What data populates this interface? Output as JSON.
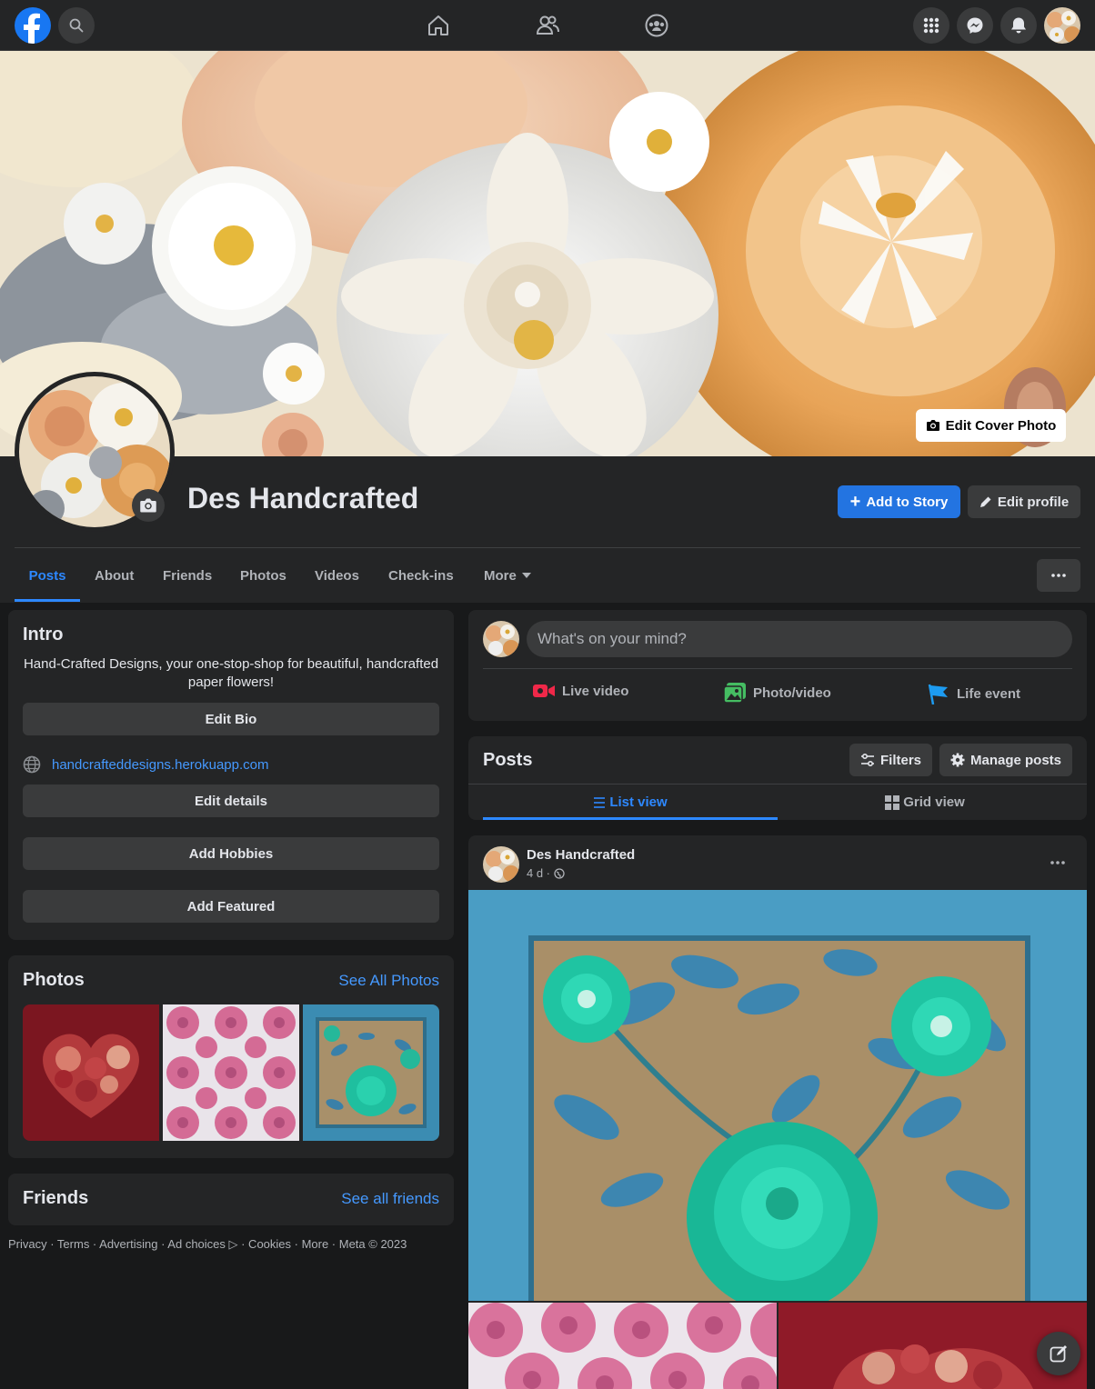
{
  "nav": {
    "icons": [
      "facebook-logo-icon",
      "search-icon",
      "home-icon",
      "friends-icon",
      "groups-icon",
      "menu-grid-icon",
      "messenger-icon",
      "notifications-icon",
      "account-avatar"
    ]
  },
  "cover": {
    "edit_label": "Edit Cover Photo"
  },
  "profile": {
    "name": "Des Handcrafted",
    "add_story_label": "Add to Story",
    "edit_profile_label": "Edit profile"
  },
  "tabs": [
    {
      "label": "Posts",
      "active": true
    },
    {
      "label": "About"
    },
    {
      "label": "Friends"
    },
    {
      "label": "Photos"
    },
    {
      "label": "Videos"
    },
    {
      "label": "Check-ins"
    },
    {
      "label": "More"
    }
  ],
  "intro": {
    "title": "Intro",
    "bio": "Hand-Crafted Designs, your one-stop-shop for beautiful, handcrafted paper flowers!",
    "edit_bio": "Edit Bio",
    "website": "handcrafteddesigns.herokuapp.com",
    "edit_details": "Edit details",
    "add_hobbies": "Add Hobbies",
    "add_featured": "Add Featured"
  },
  "photos": {
    "title": "Photos",
    "see_all": "See All Photos"
  },
  "friends": {
    "title": "Friends",
    "see_all": "See all friends"
  },
  "footer": {
    "text": "Privacy · Terms · Advertising · Ad choices ▷ · Cookies · More · Meta © 2023"
  },
  "composer": {
    "placeholder": "What's on your mind?",
    "live_video": "Live video",
    "photo_video": "Photo/video",
    "life_event": "Life event"
  },
  "posts_header": {
    "title": "Posts",
    "filters": "Filters",
    "manage": "Manage posts",
    "list_view": "List view",
    "grid_view": "Grid view"
  },
  "post": {
    "author": "Des Handcrafted",
    "time": "4 d ·"
  },
  "colors": {
    "accent": "#2d88ff",
    "button_blue": "#2374e1",
    "surface": "#242526",
    "background": "#18191a"
  }
}
